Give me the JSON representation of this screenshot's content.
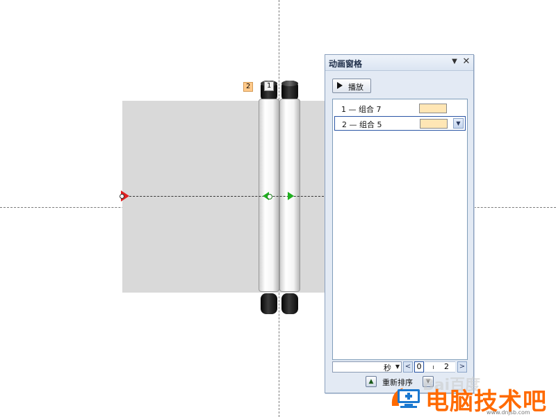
{
  "slide": {
    "order_tags": [
      "2",
      "1"
    ]
  },
  "animation_pane": {
    "title": "动画窗格",
    "menu_glyph": "▼",
    "close_glyph": "✕",
    "play_label": "播放",
    "items": [
      {
        "text": "1 —  组合 7",
        "selected": false
      },
      {
        "text": "2 —  组合 5",
        "selected": true
      }
    ],
    "timeline": {
      "unit_label": "秒",
      "start_value": "0",
      "next_value": "2"
    },
    "reorder_label": "重新排序"
  },
  "watermark": {
    "brand_text": "电脑技术吧",
    "faint_text": "Bai百度",
    "url": "www.dnjsb.com"
  },
  "colors": {
    "tag_highlight": "#ffc98a",
    "timing_bar": "#ffe6b5",
    "motion_start": "#e02020",
    "motion_end": "#20b020",
    "watermark": "#ff6a00"
  }
}
